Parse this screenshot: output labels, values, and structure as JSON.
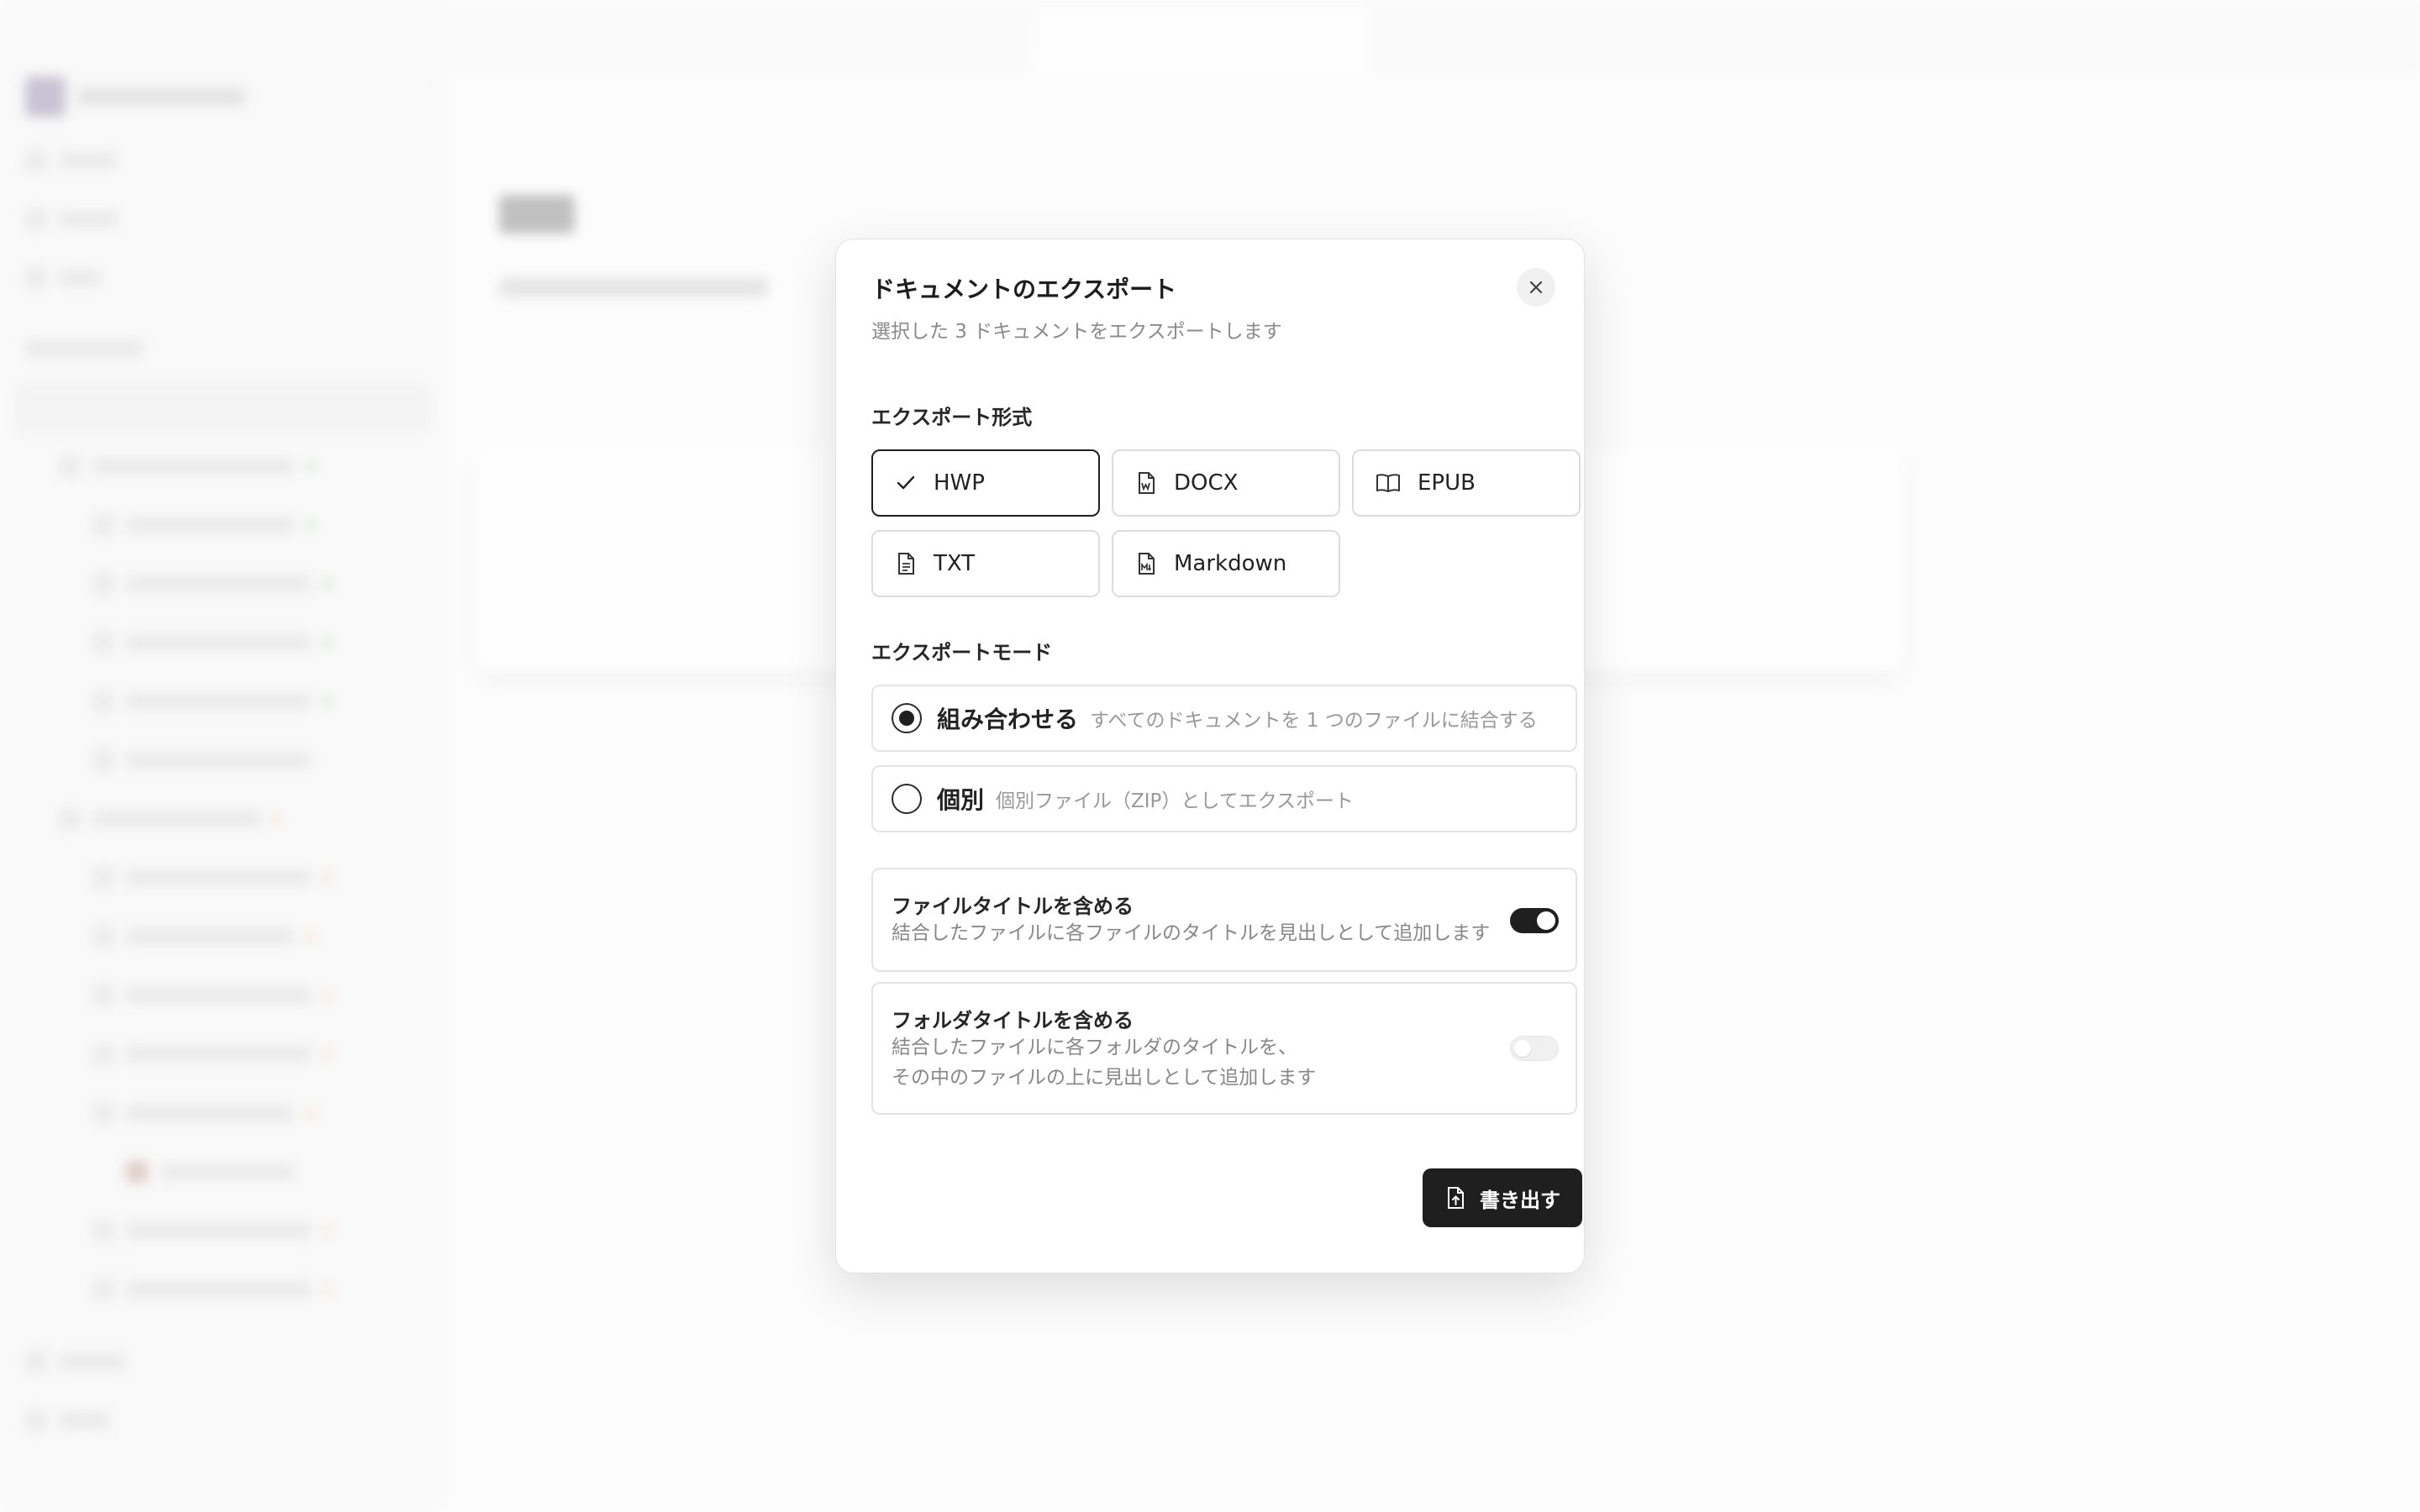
{
  "dialog": {
    "title": "ドキュメントのエクスポート",
    "description": "選択した 3 ドキュメントをエクスポートします",
    "format_section_label": "エクスポート形式",
    "formats": [
      {
        "label": "HWP",
        "icon": "check-icon",
        "selected": true
      },
      {
        "label": "DOCX",
        "icon": "word-file-icon",
        "selected": false
      },
      {
        "label": "EPUB",
        "icon": "book-open-icon",
        "selected": false
      },
      {
        "label": "TXT",
        "icon": "text-file-icon",
        "selected": false
      },
      {
        "label": "Markdown",
        "icon": "markdown-file-icon",
        "selected": false
      }
    ],
    "mode_section_label": "エクスポートモード",
    "modes": [
      {
        "label": "組み合わせる",
        "description": "すべてのドキュメントを 1 つのファイルに結合する",
        "selected": true
      },
      {
        "label": "個別",
        "description": "個別ファイル（ZIP）としてエクスポート",
        "selected": false
      }
    ],
    "options": [
      {
        "title": "ファイルタイトルを含める",
        "description_line1": "結合したファイルに各ファイルのタイトルを見出しとして追加します",
        "enabled": true
      },
      {
        "title": "フォルダタイトルを含める",
        "description_line1": "結合したファイルに各フォルダのタイトルを、",
        "description_line2": "その中のファイルの上に見出しとして追加します",
        "enabled": false
      }
    ],
    "export_button": "書き出す"
  },
  "colors": {
    "primary": "#1f1f1f",
    "muted_text": "#8a8a8a",
    "border": "#e4e4e4"
  }
}
